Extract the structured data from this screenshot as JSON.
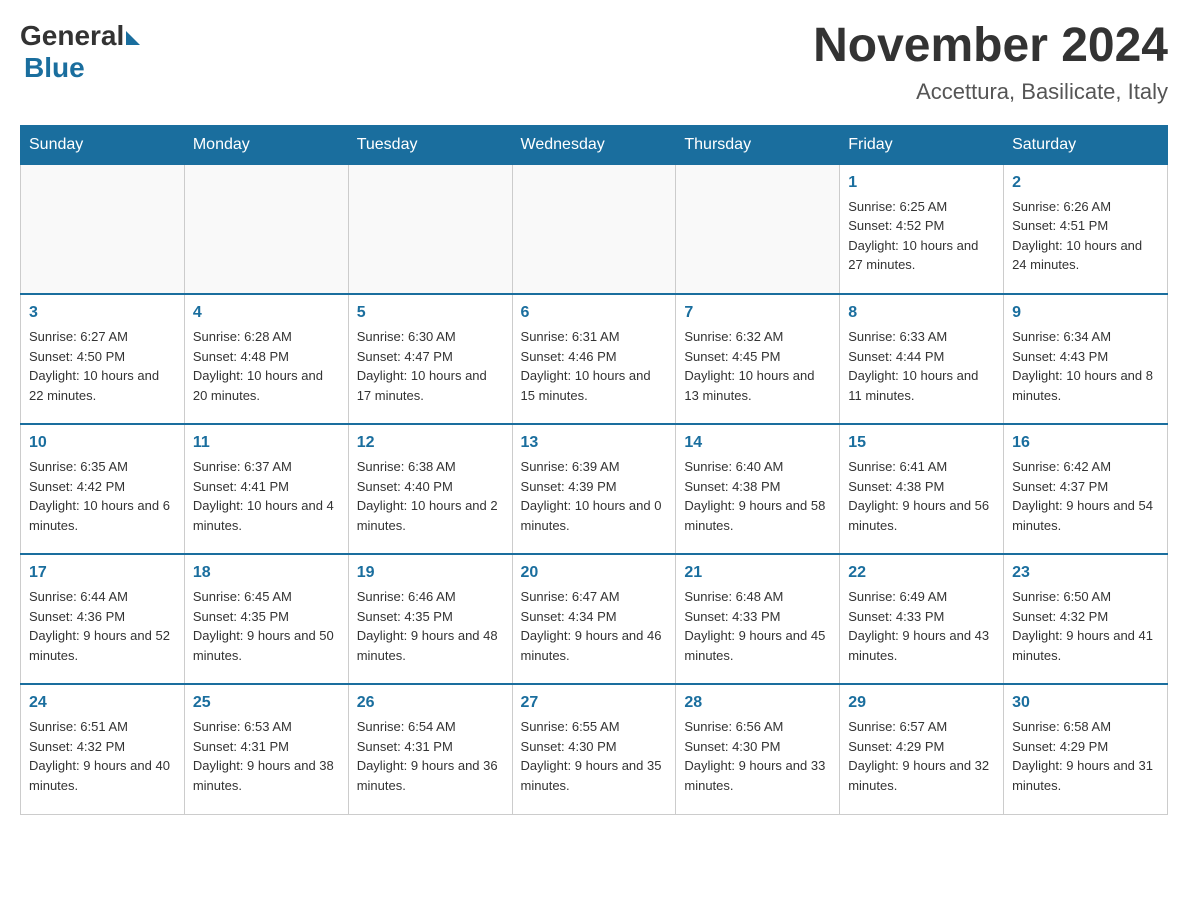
{
  "header": {
    "logo_general": "General",
    "logo_blue": "Blue",
    "month_title": "November 2024",
    "location": "Accettura, Basilicate, Italy"
  },
  "days_of_week": [
    "Sunday",
    "Monday",
    "Tuesday",
    "Wednesday",
    "Thursday",
    "Friday",
    "Saturday"
  ],
  "weeks": [
    [
      {
        "day": "",
        "info": ""
      },
      {
        "day": "",
        "info": ""
      },
      {
        "day": "",
        "info": ""
      },
      {
        "day": "",
        "info": ""
      },
      {
        "day": "",
        "info": ""
      },
      {
        "day": "1",
        "info": "Sunrise: 6:25 AM\nSunset: 4:52 PM\nDaylight: 10 hours and 27 minutes."
      },
      {
        "day": "2",
        "info": "Sunrise: 6:26 AM\nSunset: 4:51 PM\nDaylight: 10 hours and 24 minutes."
      }
    ],
    [
      {
        "day": "3",
        "info": "Sunrise: 6:27 AM\nSunset: 4:50 PM\nDaylight: 10 hours and 22 minutes."
      },
      {
        "day": "4",
        "info": "Sunrise: 6:28 AM\nSunset: 4:48 PM\nDaylight: 10 hours and 20 minutes."
      },
      {
        "day": "5",
        "info": "Sunrise: 6:30 AM\nSunset: 4:47 PM\nDaylight: 10 hours and 17 minutes."
      },
      {
        "day": "6",
        "info": "Sunrise: 6:31 AM\nSunset: 4:46 PM\nDaylight: 10 hours and 15 minutes."
      },
      {
        "day": "7",
        "info": "Sunrise: 6:32 AM\nSunset: 4:45 PM\nDaylight: 10 hours and 13 minutes."
      },
      {
        "day": "8",
        "info": "Sunrise: 6:33 AM\nSunset: 4:44 PM\nDaylight: 10 hours and 11 minutes."
      },
      {
        "day": "9",
        "info": "Sunrise: 6:34 AM\nSunset: 4:43 PM\nDaylight: 10 hours and 8 minutes."
      }
    ],
    [
      {
        "day": "10",
        "info": "Sunrise: 6:35 AM\nSunset: 4:42 PM\nDaylight: 10 hours and 6 minutes."
      },
      {
        "day": "11",
        "info": "Sunrise: 6:37 AM\nSunset: 4:41 PM\nDaylight: 10 hours and 4 minutes."
      },
      {
        "day": "12",
        "info": "Sunrise: 6:38 AM\nSunset: 4:40 PM\nDaylight: 10 hours and 2 minutes."
      },
      {
        "day": "13",
        "info": "Sunrise: 6:39 AM\nSunset: 4:39 PM\nDaylight: 10 hours and 0 minutes."
      },
      {
        "day": "14",
        "info": "Sunrise: 6:40 AM\nSunset: 4:38 PM\nDaylight: 9 hours and 58 minutes."
      },
      {
        "day": "15",
        "info": "Sunrise: 6:41 AM\nSunset: 4:38 PM\nDaylight: 9 hours and 56 minutes."
      },
      {
        "day": "16",
        "info": "Sunrise: 6:42 AM\nSunset: 4:37 PM\nDaylight: 9 hours and 54 minutes."
      }
    ],
    [
      {
        "day": "17",
        "info": "Sunrise: 6:44 AM\nSunset: 4:36 PM\nDaylight: 9 hours and 52 minutes."
      },
      {
        "day": "18",
        "info": "Sunrise: 6:45 AM\nSunset: 4:35 PM\nDaylight: 9 hours and 50 minutes."
      },
      {
        "day": "19",
        "info": "Sunrise: 6:46 AM\nSunset: 4:35 PM\nDaylight: 9 hours and 48 minutes."
      },
      {
        "day": "20",
        "info": "Sunrise: 6:47 AM\nSunset: 4:34 PM\nDaylight: 9 hours and 46 minutes."
      },
      {
        "day": "21",
        "info": "Sunrise: 6:48 AM\nSunset: 4:33 PM\nDaylight: 9 hours and 45 minutes."
      },
      {
        "day": "22",
        "info": "Sunrise: 6:49 AM\nSunset: 4:33 PM\nDaylight: 9 hours and 43 minutes."
      },
      {
        "day": "23",
        "info": "Sunrise: 6:50 AM\nSunset: 4:32 PM\nDaylight: 9 hours and 41 minutes."
      }
    ],
    [
      {
        "day": "24",
        "info": "Sunrise: 6:51 AM\nSunset: 4:32 PM\nDaylight: 9 hours and 40 minutes."
      },
      {
        "day": "25",
        "info": "Sunrise: 6:53 AM\nSunset: 4:31 PM\nDaylight: 9 hours and 38 minutes."
      },
      {
        "day": "26",
        "info": "Sunrise: 6:54 AM\nSunset: 4:31 PM\nDaylight: 9 hours and 36 minutes."
      },
      {
        "day": "27",
        "info": "Sunrise: 6:55 AM\nSunset: 4:30 PM\nDaylight: 9 hours and 35 minutes."
      },
      {
        "day": "28",
        "info": "Sunrise: 6:56 AM\nSunset: 4:30 PM\nDaylight: 9 hours and 33 minutes."
      },
      {
        "day": "29",
        "info": "Sunrise: 6:57 AM\nSunset: 4:29 PM\nDaylight: 9 hours and 32 minutes."
      },
      {
        "day": "30",
        "info": "Sunrise: 6:58 AM\nSunset: 4:29 PM\nDaylight: 9 hours and 31 minutes."
      }
    ]
  ]
}
